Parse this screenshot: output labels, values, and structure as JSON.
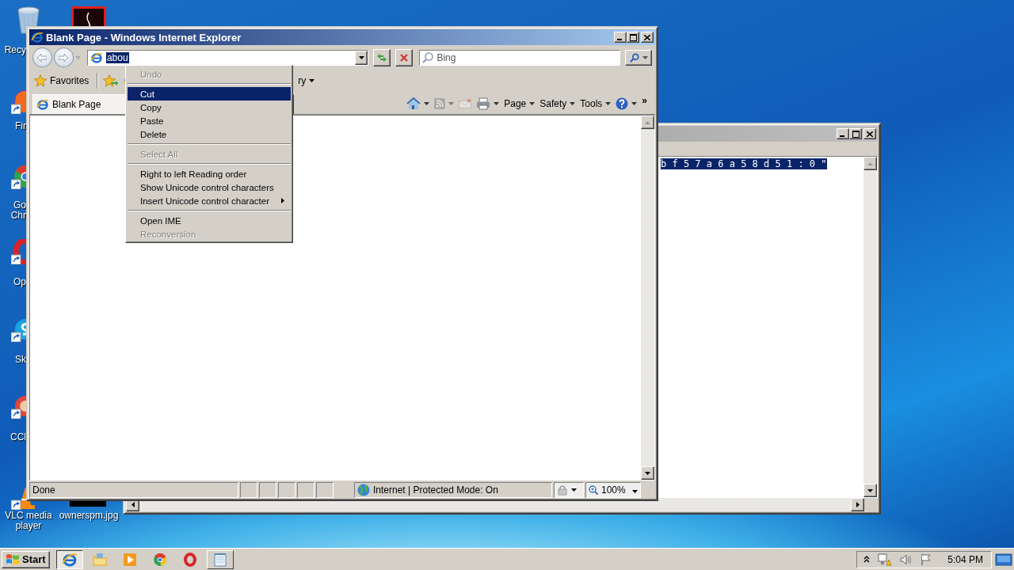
{
  "desktop_icons": [
    {
      "kind": "recycle-bin",
      "label_lines": [
        "Recy"
      ]
    },
    {
      "kind": "document"
    },
    {
      "kind": "firefox",
      "label_lines": [
        "Fir"
      ]
    },
    {
      "kind": "chrome",
      "label_lines": [
        "Go",
        "Chr"
      ]
    },
    {
      "kind": "opera",
      "label_lines": [
        "Op"
      ]
    },
    {
      "kind": "skype",
      "label_lines": [
        "Sk"
      ]
    },
    {
      "kind": "ccleaner",
      "label_lines": [
        "CCl"
      ]
    },
    {
      "kind": "vlc",
      "label_lines": [
        "VLC media",
        "player"
      ]
    },
    {
      "kind": "image",
      "label_lines": [
        "ownerspm.jpg"
      ]
    }
  ],
  "back_window": {
    "selected_text": "b f 5 7 a 6 a 5 8 d 5 1 : 0 \""
  },
  "browser": {
    "title": "Blank Page - Windows Internet Explorer",
    "address": {
      "value": "abou",
      "text_selected": true
    },
    "search": {
      "placeholder": "Bing"
    },
    "favorites": {
      "label": "Favorites",
      "fragment": "ry"
    },
    "tab": {
      "label": "Blank Page",
      "selected": true
    },
    "command_bar": [
      {
        "kind": "home",
        "dropdown": true,
        "disabled": false
      },
      {
        "kind": "feeds",
        "dropdown": true,
        "disabled": true
      },
      {
        "kind": "mail",
        "dropdown": false,
        "disabled": true
      },
      {
        "kind": "print",
        "dropdown": true,
        "disabled": false
      },
      {
        "kind": "menu",
        "label": "Page",
        "dropdown": true,
        "disabled": false
      },
      {
        "kind": "menu",
        "label": "Safety",
        "dropdown": true,
        "disabled": false
      },
      {
        "kind": "menu",
        "label": "Tools",
        "dropdown": true,
        "disabled": false
      },
      {
        "kind": "help",
        "dropdown": true,
        "disabled": false
      }
    ],
    "overflow": "»",
    "status_bar": {
      "text": "Done",
      "zone": "Internet | Protected Mode: On",
      "zoom": "100%"
    }
  },
  "context_menu": [
    {
      "kind": "item",
      "label": "Undo",
      "disabled": true,
      "selected": false,
      "submenu": false
    },
    {
      "kind": "separator"
    },
    {
      "kind": "item",
      "label": "Cut",
      "disabled": false,
      "selected": true,
      "submenu": false
    },
    {
      "kind": "item",
      "label": "Copy",
      "disabled": false,
      "selected": false,
      "submenu": false
    },
    {
      "kind": "item",
      "label": "Paste",
      "disabled": false,
      "selected": false,
      "submenu": false
    },
    {
      "kind": "item",
      "label": "Delete",
      "disabled": false,
      "selected": false,
      "submenu": false
    },
    {
      "kind": "separator"
    },
    {
      "kind": "item",
      "label": "Select All",
      "disabled": true,
      "selected": false,
      "submenu": false
    },
    {
      "kind": "separator"
    },
    {
      "kind": "item",
      "label": "Right to left Reading order",
      "disabled": false,
      "selected": false,
      "submenu": false
    },
    {
      "kind": "item",
      "label": "Show Unicode control characters",
      "disabled": false,
      "selected": false,
      "submenu": false
    },
    {
      "kind": "item",
      "label": "Insert Unicode control character",
      "disabled": false,
      "selected": false,
      "submenu": true
    },
    {
      "kind": "separator"
    },
    {
      "kind": "item",
      "label": "Open IME",
      "disabled": false,
      "selected": false,
      "submenu": false
    },
    {
      "kind": "item",
      "label": "Reconversion",
      "disabled": true,
      "selected": false,
      "submenu": false
    }
  ],
  "taskbar": {
    "start": "Start",
    "buttons": [
      {
        "kind": "ie",
        "selected": true,
        "running": true
      },
      {
        "kind": "explorer",
        "selected": false,
        "running": false
      },
      {
        "kind": "media",
        "selected": false,
        "running": false
      },
      {
        "kind": "chrome",
        "selected": false,
        "running": false
      },
      {
        "kind": "opera",
        "selected": false,
        "running": false
      },
      {
        "kind": "notepad",
        "selected": false,
        "running": true
      }
    ],
    "clock": "5:04 PM"
  }
}
